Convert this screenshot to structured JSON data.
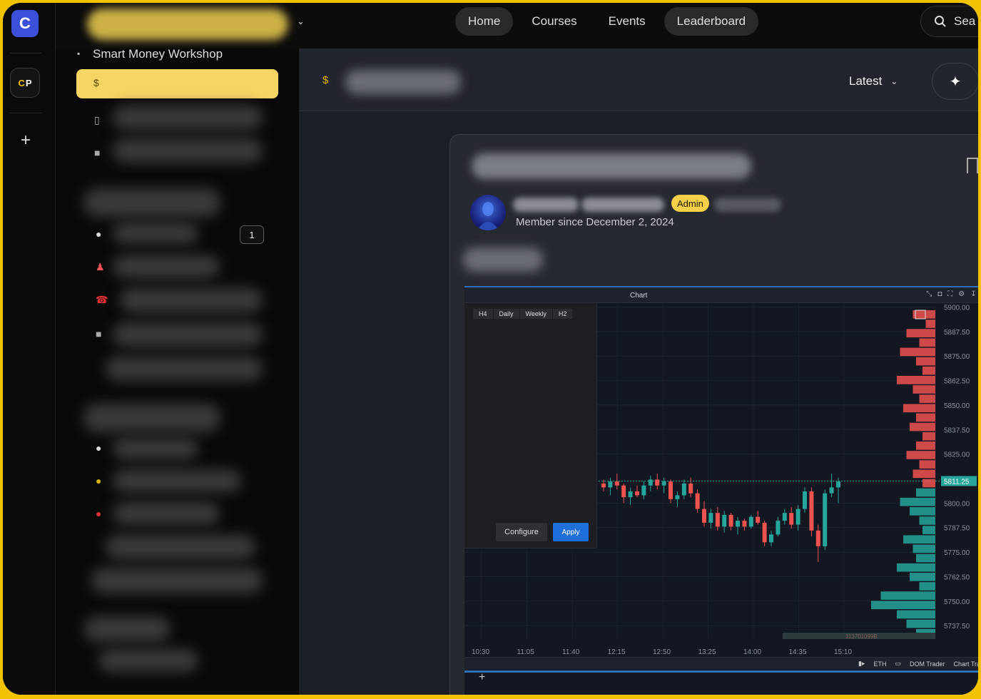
{
  "app": {
    "logo_letter": "C",
    "workspace_badge": {
      "left": "C",
      "right": "P"
    },
    "add_symbol": "+",
    "chevron": "⌄"
  },
  "nav": {
    "items": [
      {
        "label": "Home",
        "pill": true
      },
      {
        "label": "Courses",
        "pill": false
      },
      {
        "label": "Events",
        "pill": false
      },
      {
        "label": "Leaderboard",
        "pill": true
      }
    ],
    "search_label": "Sea"
  },
  "sidebar": {
    "top_channel": "Smart Money Workshop",
    "unread_count": "1"
  },
  "feed": {
    "sort_label": "Latest",
    "sort_chevron": "⌄",
    "spark_icon": "✦"
  },
  "post": {
    "role_badge": "Admin",
    "member_since": "Member since December 2, 2024"
  },
  "chart_panel": {
    "window_title": "Chart",
    "timeframes": [
      "H4",
      "Daily",
      "Weekly",
      "H2"
    ],
    "configure_label": "Configure",
    "apply_label": "Apply",
    "bottom_bar": [
      "ETH",
      "DOM Trader",
      "Chart Trader"
    ],
    "volume_readout": "113701099B",
    "tab_plus": "+"
  },
  "chart_data": {
    "type": "candlestick",
    "x_ticks": [
      "10:30",
      "11:05",
      "11:40",
      "12:15",
      "12:50",
      "13:25",
      "14:00",
      "14:35",
      "15:10"
    ],
    "y_ticks": [
      5900.0,
      5887.5,
      5875.0,
      5862.5,
      5850.0,
      5837.5,
      5825.0,
      5811.25,
      5800.0,
      5787.5,
      5775.0,
      5762.5,
      5750.0,
      5737.5
    ],
    "y_tick_labels": [
      "5900.00",
      "5887.50",
      "5875.00",
      "5862.50",
      "5850.00",
      "5837.50",
      "5825.00",
      "5811.25",
      "5800.00",
      "5787.50",
      "5775.00",
      "5762.50",
      "5750.00",
      "5737.50"
    ],
    "ylim": [
      5731.0,
      5902.0
    ],
    "last_price": 5811.25,
    "colors": {
      "up": "#26a69a",
      "down": "#ef5350",
      "background": "#131722",
      "last_price_tag": "#26a69a"
    },
    "candles": [
      [
        5810,
        5812,
        5806,
        5808
      ],
      [
        5808,
        5813,
        5804,
        5811
      ],
      [
        5811,
        5815,
        5807,
        5809
      ],
      [
        5809,
        5810,
        5800,
        5803
      ],
      [
        5803,
        5808,
        5799,
        5806
      ],
      [
        5806,
        5809,
        5803,
        5804
      ],
      [
        5804,
        5811,
        5802,
        5809
      ],
      [
        5809,
        5814,
        5806,
        5812
      ],
      [
        5812,
        5815,
        5807,
        5809
      ],
      [
        5809,
        5813,
        5805,
        5811
      ],
      [
        5811,
        5812,
        5800,
        5802
      ],
      [
        5802,
        5806,
        5798,
        5804
      ],
      [
        5804,
        5812,
        5802,
        5810
      ],
      [
        5810,
        5813,
        5803,
        5805
      ],
      [
        5805,
        5807,
        5795,
        5797
      ],
      [
        5797,
        5801,
        5788,
        5790
      ],
      [
        5790,
        5797,
        5787,
        5795
      ],
      [
        5795,
        5798,
        5786,
        5788
      ],
      [
        5788,
        5796,
        5785,
        5794
      ],
      [
        5794,
        5795,
        5786,
        5788
      ],
      [
        5788,
        5793,
        5784,
        5791
      ],
      [
        5791,
        5792,
        5786,
        5788
      ],
      [
        5788,
        5794,
        5787,
        5793
      ],
      [
        5793,
        5796,
        5789,
        5790
      ],
      [
        5790,
        5791,
        5778,
        5780
      ],
      [
        5780,
        5786,
        5778,
        5784
      ],
      [
        5784,
        5793,
        5783,
        5791
      ],
      [
        5791,
        5797,
        5789,
        5795
      ],
      [
        5795,
        5798,
        5787,
        5789
      ],
      [
        5789,
        5799,
        5786,
        5797
      ],
      [
        5797,
        5808,
        5795,
        5806
      ],
      [
        5806,
        5808,
        5783,
        5786
      ],
      [
        5786,
        5789,
        5770,
        5778
      ],
      [
        5778,
        5807,
        5776,
        5805
      ],
      [
        5805,
        5815,
        5803,
        5808
      ],
      [
        5808,
        5813,
        5800,
        5811
      ]
    ],
    "volume_profile_bid": [
      0.35,
      0.15,
      0.45,
      0.25,
      0.55,
      0.3,
      0.2,
      0.6,
      0.35,
      0.25,
      0.5,
      0.3,
      0.4,
      0.2,
      0.3,
      0.45,
      0.25,
      0.35,
      0.2,
      0.3,
      0.55,
      0.4,
      0.25,
      0.2,
      0.5,
      0.35,
      0.3,
      0.6,
      0.4,
      0.25,
      0.85,
      1.0,
      0.6,
      0.45,
      0.3
    ],
    "volume_profile_ask": [
      0.25,
      0.3,
      0.2,
      0.35,
      0.15,
      0.3,
      0.25,
      0.2,
      0.4,
      0.3,
      0.25,
      0.2,
      0.3,
      0.25,
      0.2,
      0.35,
      0.3,
      0.25,
      0.4,
      0.3,
      0.2,
      0.55,
      0.35,
      0.3,
      0.25,
      0.3,
      0.2,
      0.5,
      0.35,
      0.3,
      0.25,
      0.3,
      0.9,
      0.35,
      0.25
    ]
  }
}
